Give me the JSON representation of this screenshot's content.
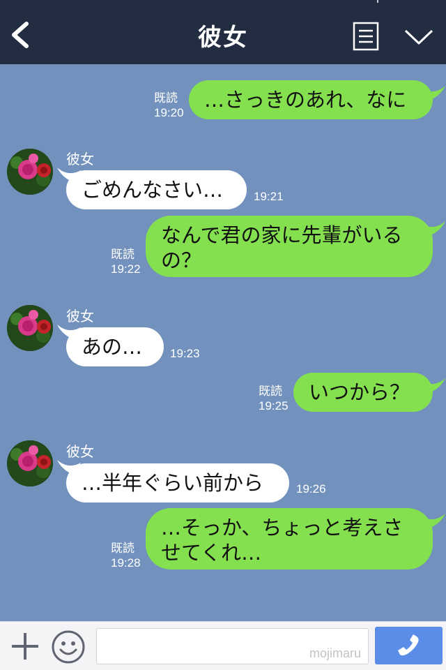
{
  "header": {
    "title": "彼女",
    "back_icon": "chevron-left-icon",
    "menu_icon": "list-icon",
    "expand_icon": "chevron-down-icon"
  },
  "colors": {
    "header_bg": "#232d42",
    "chat_bg": "#7292bd",
    "sent_bubble": "#84e04f",
    "received_bubble": "#ffffff",
    "send_button": "#5b8de8"
  },
  "messages": [
    {
      "direction": "sent",
      "text": "…さっきのあれ、なに",
      "read": "既読",
      "time": "19:20"
    },
    {
      "direction": "received",
      "sender": "彼女",
      "text": "ごめんなさい…",
      "time": "19:21"
    },
    {
      "direction": "sent",
      "text": "なんで君の家に先輩がいるの？",
      "read": "既読",
      "time": "19:22"
    },
    {
      "direction": "received",
      "sender": "彼女",
      "text": "あの…",
      "time": "19:23"
    },
    {
      "direction": "sent",
      "text": "いつから？",
      "read": "既読",
      "time": "19:25"
    },
    {
      "direction": "received",
      "sender": "彼女",
      "text": "…半年ぐらい前から",
      "time": "19:26"
    },
    {
      "direction": "sent",
      "text": "…そっか、ちょっと考えさせてくれ…",
      "read": "既読",
      "time": "19:28"
    }
  ],
  "footer": {
    "plus_icon": "plus-icon",
    "emoji_icon": "smiley-icon",
    "input_value": "",
    "watermark": "mojimaru",
    "send_icon": "phone-icon"
  }
}
